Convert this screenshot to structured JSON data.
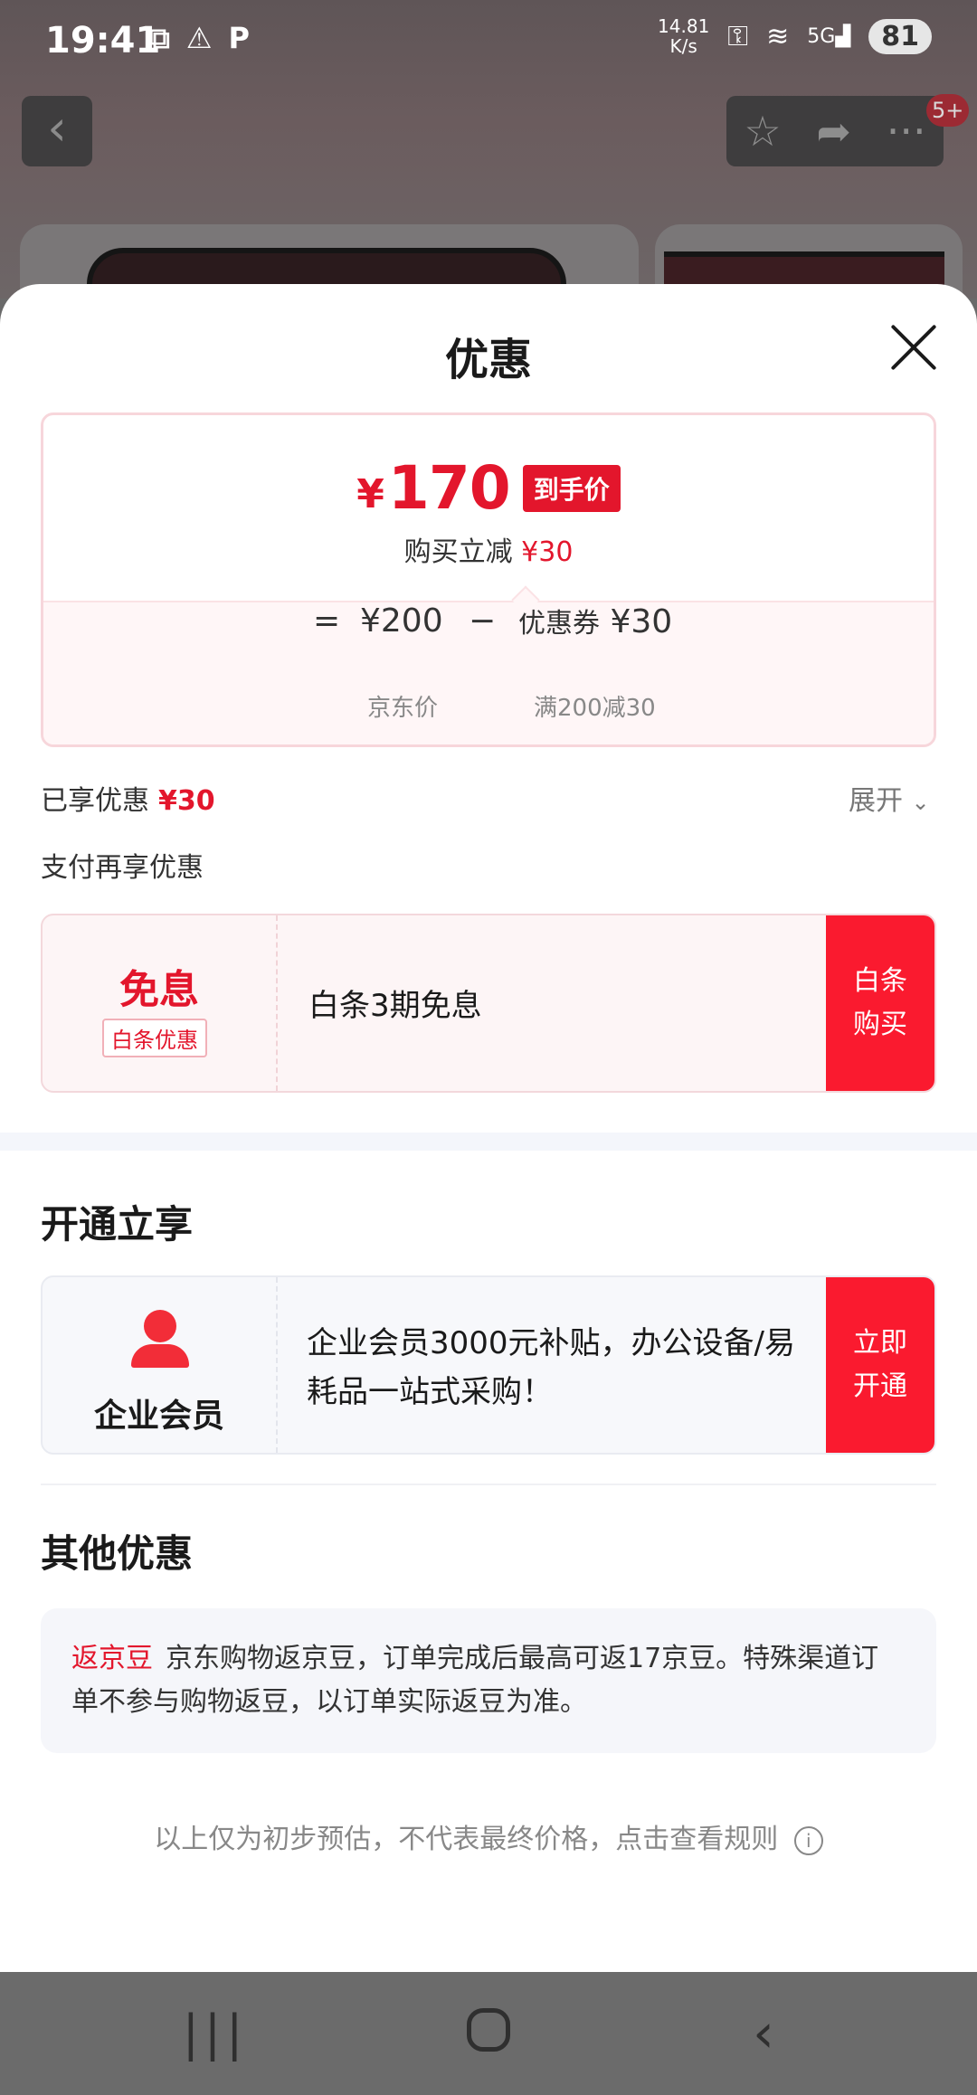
{
  "status_bar": {
    "time": "19:41",
    "net_speed_value": "14.81",
    "net_speed_unit": "K/s",
    "network": "5G",
    "battery": "81",
    "icons": [
      "screenshot-icon",
      "warning-icon",
      "parking-icon",
      "key-icon",
      "wifi-icon",
      "signal-icon"
    ]
  },
  "background": {
    "badge": "5+"
  },
  "sheet": {
    "title": "优惠",
    "price": {
      "currency": "¥",
      "final_price": "170",
      "final_tag": "到手价",
      "sub_label": "购买立减",
      "sub_value": "¥30",
      "equals": "=",
      "jd_price": "¥200",
      "minus": "−",
      "coupon_label": "优惠券",
      "coupon_value": "¥30",
      "jd_price_label": "京东价",
      "coupon_rule": "满200减30"
    },
    "enjoyed_label": "已享优惠",
    "enjoyed_value": "¥30",
    "expand_label": "展开",
    "pay_more_label": "支付再享优惠",
    "baitiao": {
      "title": "免息",
      "subtitle": "白条优惠",
      "description": "白条3期免息",
      "button": "白条购买"
    },
    "open_section_title": "开通立享",
    "enterprise": {
      "label": "企业会员",
      "description": "企业会员3000元补贴，办公设备/易耗品一站式采购！",
      "button": "立即开通"
    },
    "other_section_title": "其他优惠",
    "other": {
      "tag": "返京豆",
      "text": "京东购物返京豆，订单完成后最高可返17京豆。特殊渠道订单不参与购物返豆，以订单实际返豆为准。"
    },
    "footnote": "以上仅为初步预估，不代表最终价格，点击查看规则"
  },
  "colors": {
    "accent_red": "#e3162c",
    "button_red": "#fa1a2f"
  }
}
